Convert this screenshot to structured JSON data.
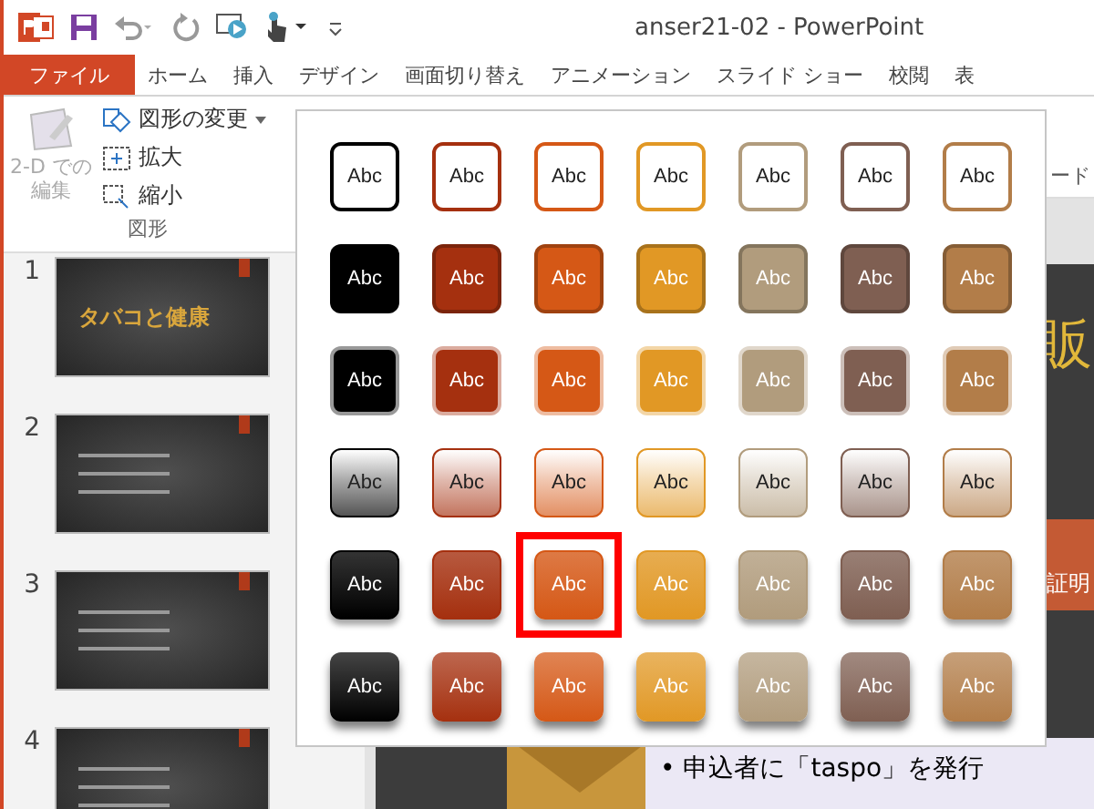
{
  "window": {
    "title": "anser21-02 - PowerPoint"
  },
  "tabs": [
    {
      "label": "ファイル",
      "kind": "file",
      "selected": false
    },
    {
      "label": "ホーム",
      "kind": "tab",
      "selected": false
    },
    {
      "label": "挿入",
      "kind": "tab",
      "selected": false
    },
    {
      "label": "デザイン",
      "kind": "tab",
      "selected": false
    },
    {
      "label": "画面切り替え",
      "kind": "tab",
      "selected": false
    },
    {
      "label": "アニメーション",
      "kind": "tab",
      "selected": false
    },
    {
      "label": "スライド ショー",
      "kind": "tab",
      "selected": false
    },
    {
      "label": "校閲",
      "kind": "tab",
      "selected": false
    },
    {
      "label": "表",
      "kind": "tab",
      "selected": false
    }
  ],
  "ribbon": {
    "edit_2d": {
      "lines": [
        "2-D での",
        "編集"
      ],
      "disabled": true
    },
    "change_shape": "図形の変更",
    "enlarge": "拡大",
    "shrink": "縮小",
    "group_label": "図形",
    "wordart_label": "ード"
  },
  "slides": [
    {
      "number": "1",
      "title": "タバコと健康"
    },
    {
      "number": "2"
    },
    {
      "number": "3"
    },
    {
      "number": "4"
    }
  ],
  "gallery": {
    "rows": [
      {
        "kind": "outline",
        "cells": [
          {
            "label": "Abc",
            "color": "#000000",
            "selected": false
          },
          {
            "label": "Abc",
            "color": "#a5300f",
            "selected": false
          },
          {
            "label": "Abc",
            "color": "#d55816",
            "selected": false
          },
          {
            "label": "Abc",
            "color": "#e19825",
            "selected": false
          },
          {
            "label": "Abc",
            "color": "#b19c7d",
            "selected": false
          },
          {
            "label": "Abc",
            "color": "#7f5f52",
            "selected": false
          },
          {
            "label": "Abc",
            "color": "#b27d49",
            "selected": false
          }
        ]
      },
      {
        "kind": "filled",
        "cells": [
          {
            "label": "Abc",
            "color": "#000000",
            "selected": false
          },
          {
            "label": "Abc",
            "color": "#a5300f",
            "selected": false
          },
          {
            "label": "Abc",
            "color": "#d55816",
            "selected": false
          },
          {
            "label": "Abc",
            "color": "#e19825",
            "selected": false
          },
          {
            "label": "Abc",
            "color": "#b19c7d",
            "selected": false
          },
          {
            "label": "Abc",
            "color": "#7f5f52",
            "selected": false
          },
          {
            "label": "Abc",
            "color": "#b27d49",
            "selected": false
          }
        ]
      },
      {
        "kind": "flat",
        "cells": [
          {
            "label": "Abc",
            "color": "#000000",
            "selected": false
          },
          {
            "label": "Abc",
            "color": "#a5300f",
            "selected": false
          },
          {
            "label": "Abc",
            "color": "#d55816",
            "selected": false
          },
          {
            "label": "Abc",
            "color": "#e19825",
            "selected": false
          },
          {
            "label": "Abc",
            "color": "#b19c7d",
            "selected": false
          },
          {
            "label": "Abc",
            "color": "#7f5f52",
            "selected": false
          },
          {
            "label": "Abc",
            "color": "#b27d49",
            "selected": false
          }
        ]
      },
      {
        "kind": "light",
        "cells": [
          {
            "label": "Abc",
            "color": "#000000",
            "selected": false
          },
          {
            "label": "Abc",
            "color": "#a5300f",
            "selected": false
          },
          {
            "label": "Abc",
            "color": "#d55816",
            "selected": false
          },
          {
            "label": "Abc",
            "color": "#e19825",
            "selected": false
          },
          {
            "label": "Abc",
            "color": "#b19c7d",
            "selected": false
          },
          {
            "label": "Abc",
            "color": "#7f5f52",
            "selected": false
          },
          {
            "label": "Abc",
            "color": "#b27d49",
            "selected": false
          }
        ]
      },
      {
        "kind": "gradient",
        "cells": [
          {
            "label": "Abc",
            "color": "#000000",
            "selected": false
          },
          {
            "label": "Abc",
            "color": "#a5300f",
            "selected": false
          },
          {
            "label": "Abc",
            "color": "#d55816",
            "selected": true
          },
          {
            "label": "Abc",
            "color": "#e19825",
            "selected": false
          },
          {
            "label": "Abc",
            "color": "#b19c7d",
            "selected": false
          },
          {
            "label": "Abc",
            "color": "#7f5f52",
            "selected": false
          },
          {
            "label": "Abc",
            "color": "#b27d49",
            "selected": false
          }
        ]
      },
      {
        "kind": "shadow",
        "cells": [
          {
            "label": "Abc",
            "color": "#000000",
            "selected": false
          },
          {
            "label": "Abc",
            "color": "#a5300f",
            "selected": false
          },
          {
            "label": "Abc",
            "color": "#d55816",
            "selected": false
          },
          {
            "label": "Abc",
            "color": "#e19825",
            "selected": false
          },
          {
            "label": "Abc",
            "color": "#b19c7d",
            "selected": false
          },
          {
            "label": "Abc",
            "color": "#7f5f52",
            "selected": false
          },
          {
            "label": "Abc",
            "color": "#b27d49",
            "selected": false
          }
        ]
      }
    ]
  },
  "slide": {
    "heading": "販",
    "box_text": "証明",
    "bullet": "• 申込者に「taspo」を発行"
  }
}
